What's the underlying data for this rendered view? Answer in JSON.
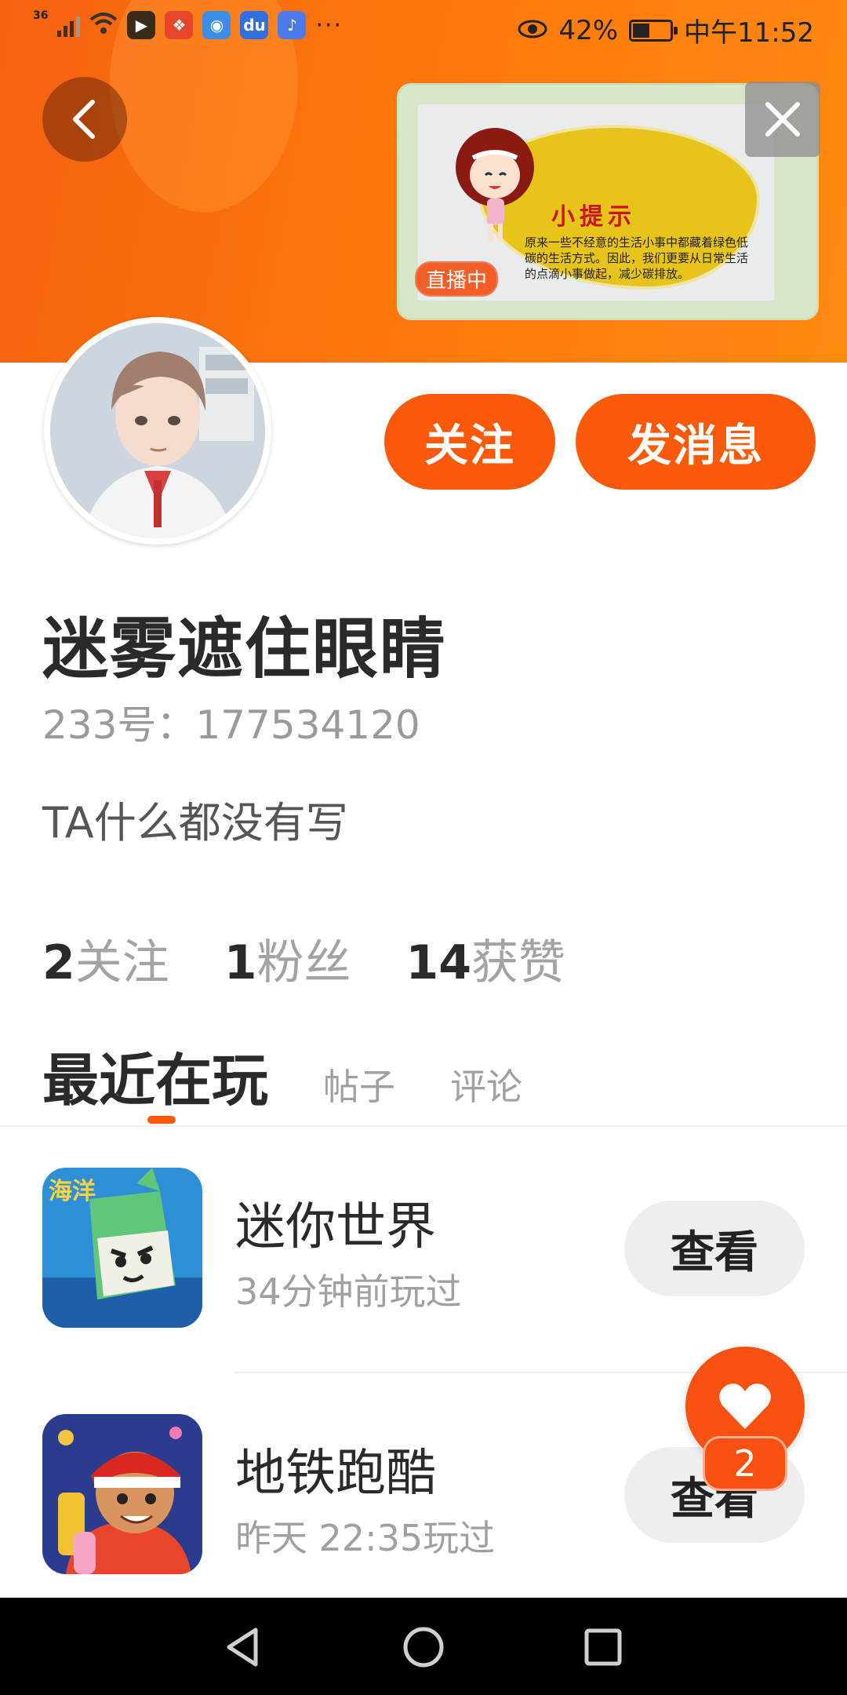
{
  "status_bar": {
    "network": "36",
    "battery": "42%",
    "time": "中午11:52",
    "more": "···"
  },
  "live": {
    "badge": "直播中",
    "tip_title": "小提示",
    "tip_text": "原来一些不经意的生活小事中都藏着绿色低碳的生活方式。因此，我们更要从日常生活的点滴小事做起，减少碳排放。"
  },
  "profile": {
    "username": "迷雾遮住眼睛",
    "uid_label": "233号：",
    "uid": "177534120",
    "bio": "TA什么都没有写",
    "follow_button": "关注",
    "message_button": "发消息"
  },
  "stats": [
    {
      "value": "2",
      "label": "关注"
    },
    {
      "value": "1",
      "label": "粉丝"
    },
    {
      "value": "14",
      "label": "获赞"
    }
  ],
  "tabs": {
    "active": "最近在玩",
    "posts": "帖子",
    "comments": "评论"
  },
  "games": [
    {
      "name": "迷你世界",
      "time": "34分钟前玩过",
      "button": "查看",
      "icon_text": "海洋"
    },
    {
      "name": "地铁跑酷",
      "time": "昨天 22:35玩过",
      "button": "查看"
    }
  ],
  "likes_badge": "2",
  "colors": {
    "accent": "#fa5a0a",
    "banner": "#ff7a0c"
  }
}
